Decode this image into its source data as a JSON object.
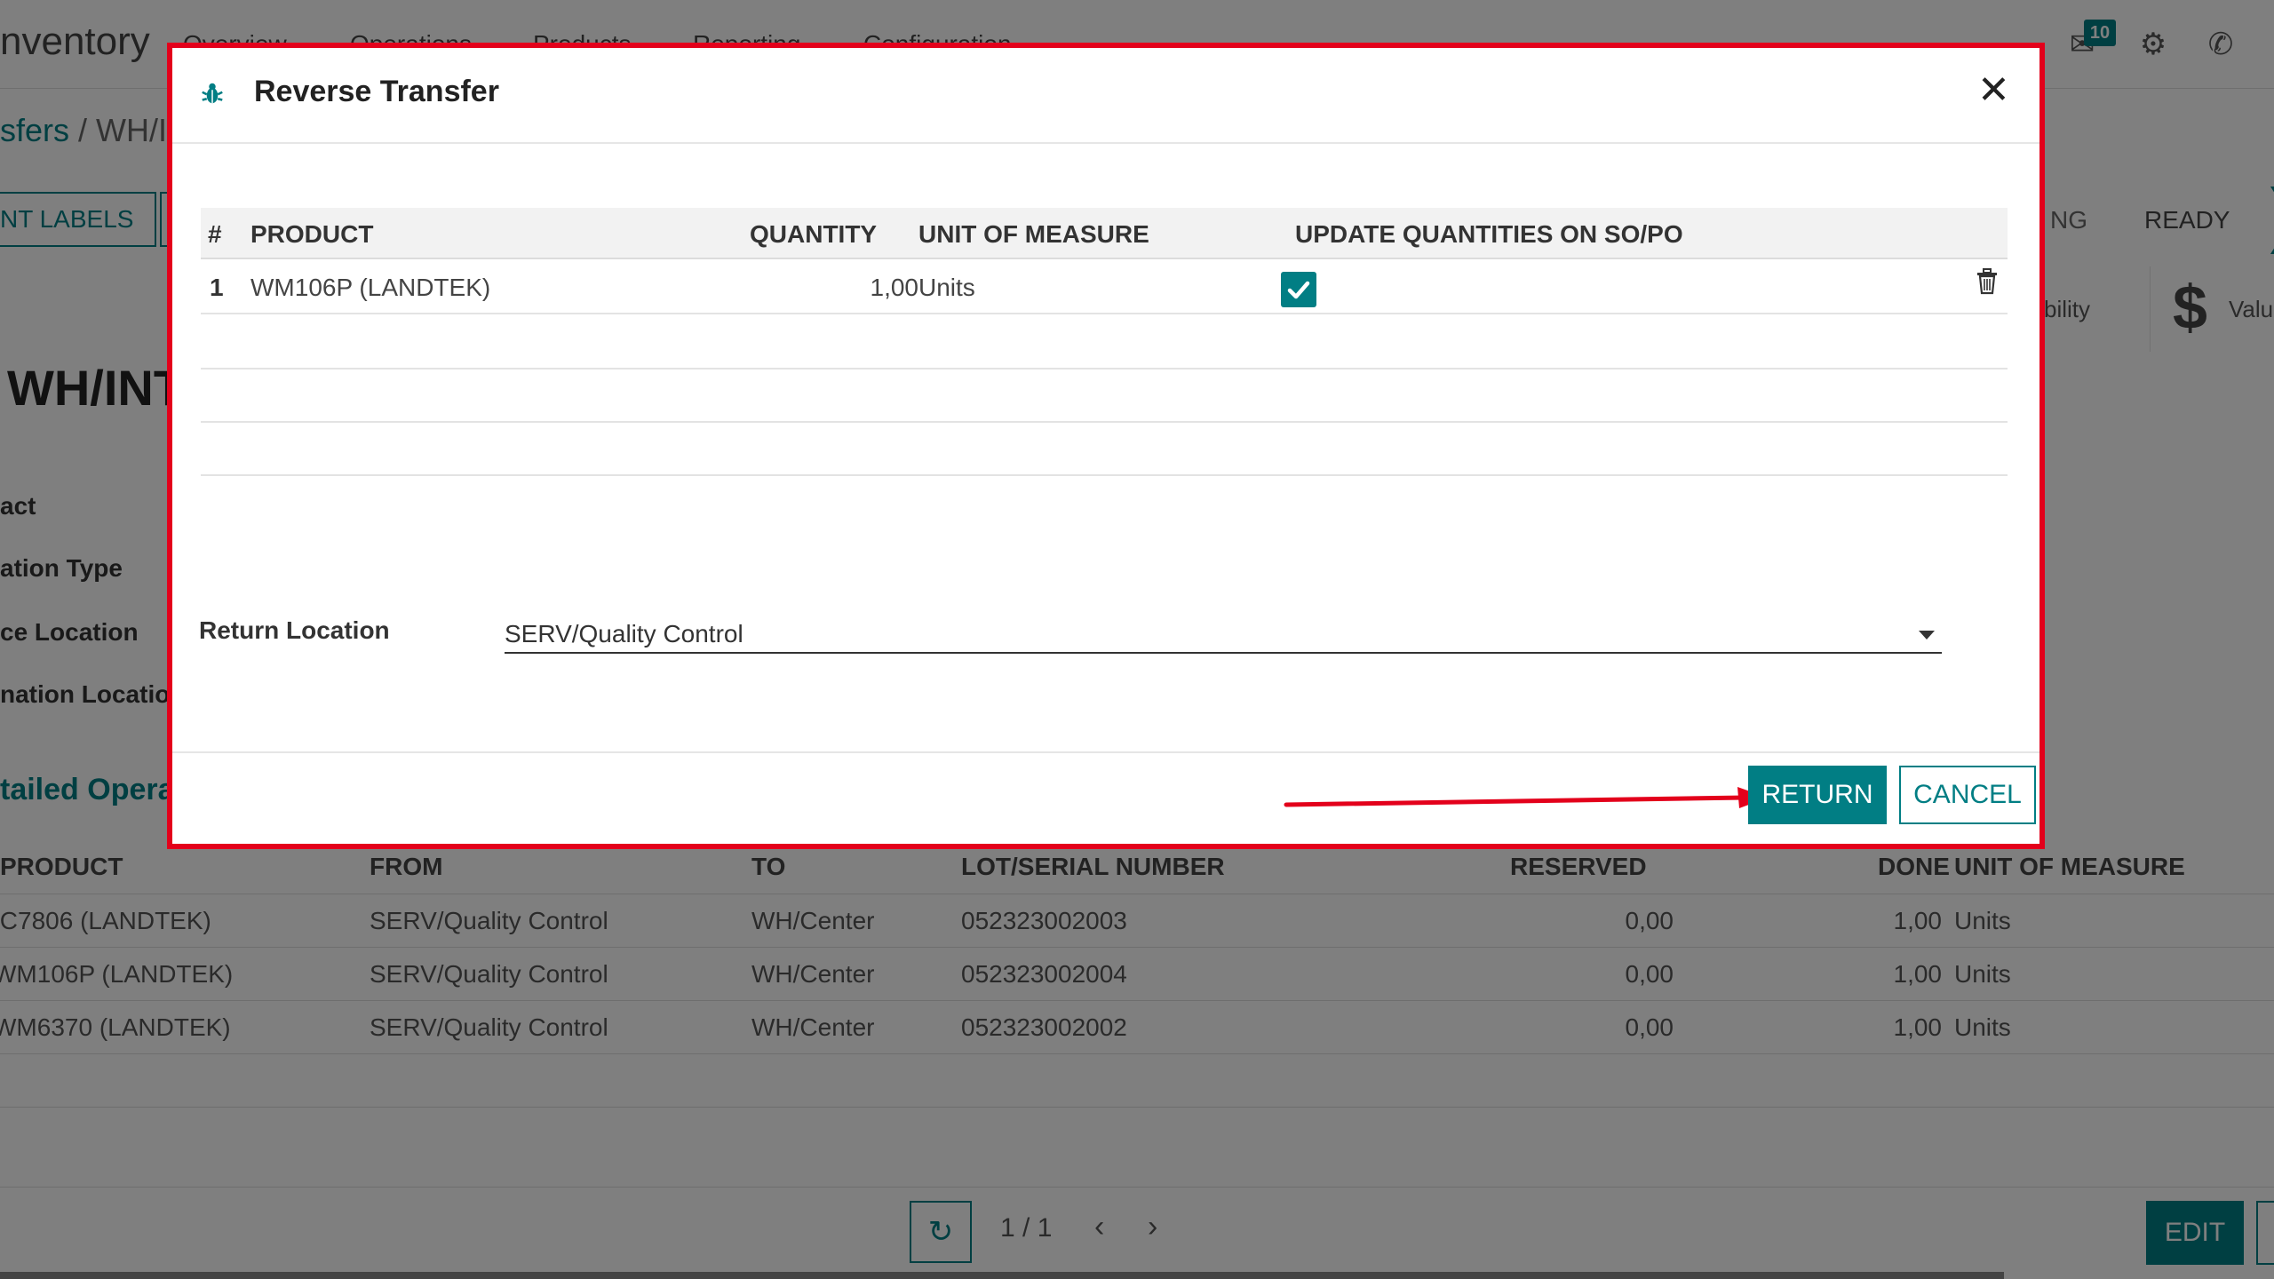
{
  "app": {
    "name": "nventory",
    "menu": [
      "Overview",
      "Operations",
      "Products",
      "Reporting",
      "Configuration"
    ],
    "message_count": "10"
  },
  "breadcrumb": {
    "link": "sfers",
    "separator": " / ",
    "current": "WH/IN"
  },
  "form": {
    "print_labels_button": "NT LABELS",
    "status": {
      "partial": "NG",
      "ready": "READY"
    },
    "smart_buttons": {
      "traceability": "bility",
      "valuation": "Valu"
    },
    "title": "WH/INT",
    "field_labels": [
      "act",
      "ation Type",
      "ce Location",
      "nation Locatio"
    ],
    "tab": "tailed Opera"
  },
  "operations_table": {
    "headers": {
      "product": "PRODUCT",
      "from": "FROM",
      "to": "TO",
      "lot": "LOT/SERIAL NUMBER",
      "reserved": "RESERVED",
      "done": "DONE",
      "uom": "UNIT OF MEASURE"
    },
    "rows": [
      {
        "product": "IC7806 (LANDTEK)",
        "from": "SERV/Quality Control",
        "to": "WH/Center",
        "lot": "052323002003",
        "reserved": "0,00",
        "done": "1,00",
        "uom": "Units"
      },
      {
        "product": "WM106P (LANDTEK)",
        "from": "SERV/Quality Control",
        "to": "WH/Center",
        "lot": "052323002004",
        "reserved": "0,00",
        "done": "1,00",
        "uom": "Units"
      },
      {
        "product": "WM6370 (LANDTEK)",
        "from": "SERV/Quality Control",
        "to": "WH/Center",
        "lot": "052323002002",
        "reserved": "0,00",
        "done": "1,00",
        "uom": "Units"
      }
    ]
  },
  "pager": {
    "value": "1 / 1"
  },
  "edit_button": "EDIT",
  "dialog": {
    "title": "Reverse Transfer",
    "table": {
      "headers": {
        "index": "#",
        "product": "PRODUCT",
        "quantity": "QUANTITY",
        "uom": "UNIT OF MEASURE",
        "update": "UPDATE QUANTITIES ON SO/PO"
      },
      "rows": [
        {
          "index": "1",
          "product": "WM106P (LANDTEK)",
          "quantity": "1,00",
          "uom": "Units",
          "update": true
        }
      ]
    },
    "return_location": {
      "label": "Return Location",
      "value": "SERV/Quality Control"
    },
    "buttons": {
      "return": "RETURN",
      "cancel": "CANCEL"
    }
  },
  "colors": {
    "accent": "#017e84",
    "annotation": "#e3001b"
  }
}
